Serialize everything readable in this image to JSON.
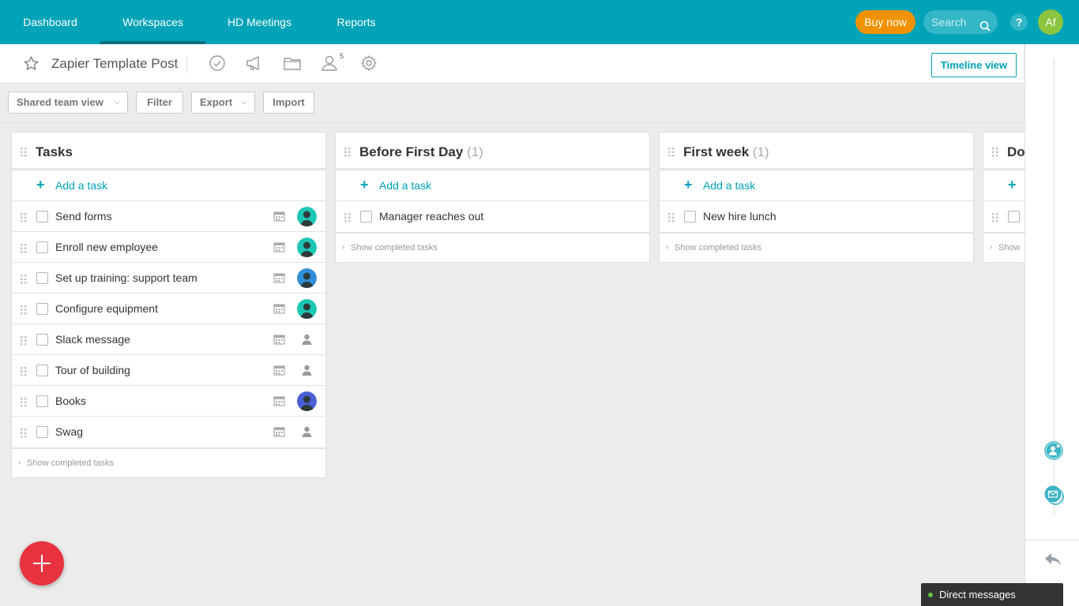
{
  "nav": {
    "items": [
      {
        "label": "Dashboard"
      },
      {
        "label": "Workspaces"
      },
      {
        "label": "HD Meetings"
      },
      {
        "label": "Reports"
      }
    ],
    "buy_label": "Buy now",
    "search_placeholder": "Search",
    "help_label": "?",
    "user_initials": "Af"
  },
  "project": {
    "title": "Zapier Template Post",
    "member_count": "5",
    "timeline_label": "Timeline view"
  },
  "toolbar": {
    "view_label": "Shared team view",
    "filter_label": "Filter",
    "export_label": "Export",
    "import_label": "Import"
  },
  "board": {
    "add_task_label": "Add a task",
    "show_completed_label": "Show completed tasks",
    "show_completed_short": "Show",
    "columns": [
      {
        "title": "Tasks",
        "count": "",
        "tasks": [
          {
            "name": "Send forms",
            "assignee": "teal"
          },
          {
            "name": "Enroll new employee",
            "assignee": "teal"
          },
          {
            "name": "Set up training: support team",
            "assignee": "blue"
          },
          {
            "name": "Configure equipment",
            "assignee": "teal"
          },
          {
            "name": "Slack message",
            "assignee": "none"
          },
          {
            "name": "Tour of building",
            "assignee": "none"
          },
          {
            "name": "Books",
            "assignee": "indigo"
          },
          {
            "name": "Swag",
            "assignee": "none"
          }
        ]
      },
      {
        "title": "Before First Day",
        "count": "(1)",
        "tasks": [
          {
            "name": "Manager reaches out"
          }
        ]
      },
      {
        "title": "First week",
        "count": "(1)",
        "tasks": [
          {
            "name": "New hire lunch"
          }
        ]
      },
      {
        "title": "Do",
        "count": "",
        "tasks": [
          {
            "name": ""
          }
        ]
      }
    ]
  },
  "direct_messages_label": "Direct messages",
  "colors": {
    "brand": "#00a3b7",
    "buy": "#f39200",
    "fab": "#e8323f",
    "avatar_teal": "#1bc6b4",
    "avatar_blue": "#2f8fd8",
    "avatar_indigo": "#4b5fd6"
  }
}
